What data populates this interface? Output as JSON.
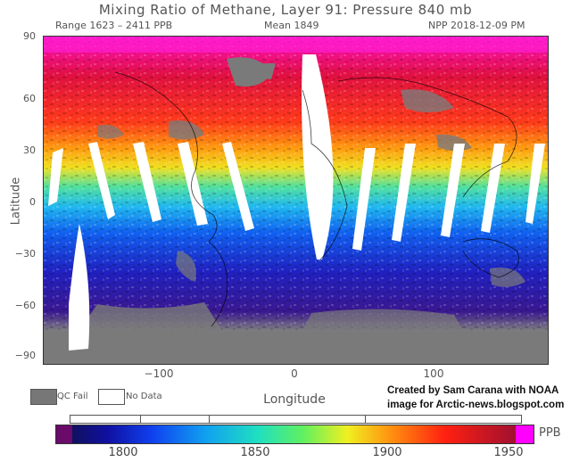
{
  "header": {
    "title": "Mixing Ratio of Methane, Layer 91: Pressure 840 mb",
    "range": "Range 1623 – 2411 PPB",
    "mean": "Mean 1849",
    "source": "NPP 2018-12-09 PM"
  },
  "axes": {
    "y_title": "Latitude",
    "x_title": "Longitude",
    "y_ticks": [
      "90",
      "60",
      "30",
      "0",
      "−30",
      "−60",
      "−90"
    ],
    "x_ticks": [
      "−100",
      "0",
      "100"
    ]
  },
  "legend": {
    "qc_fail": "QC Fail",
    "no_data": "No Data",
    "qc_fail_color": "#777777",
    "no_data_color": "#ffffff"
  },
  "credit": {
    "line1": "Created by Sam Carana with NOAA",
    "line2": "image for Arctic-news.blogspot.com"
  },
  "colorbar": {
    "unit": "PPB",
    "ticks": [
      "1800",
      "1850",
      "1900",
      "1950"
    ],
    "low_color": "#6a0a6a",
    "high_color": "#ff00ff"
  }
}
